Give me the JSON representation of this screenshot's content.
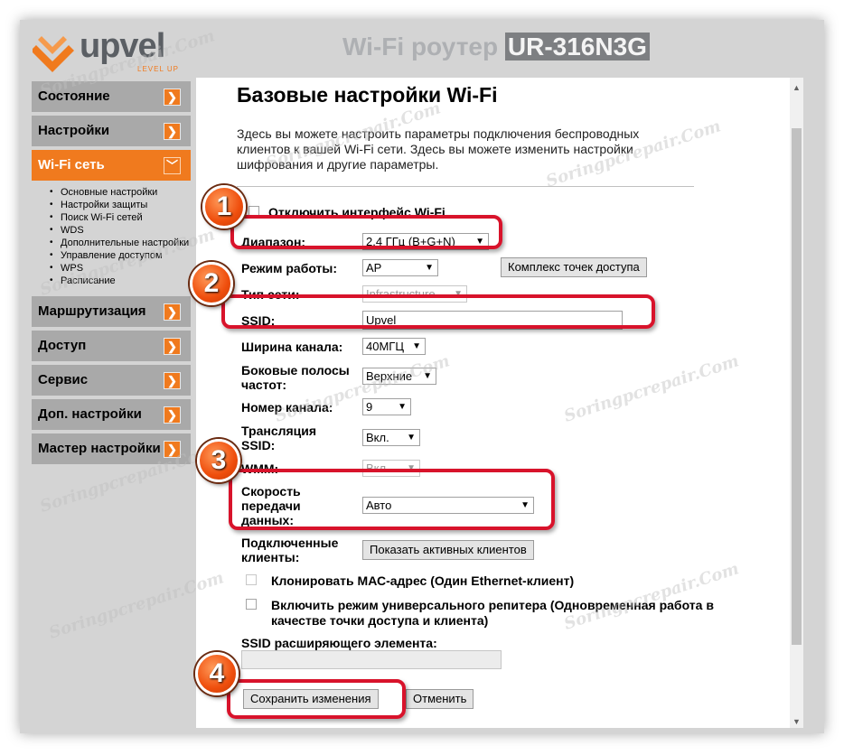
{
  "header": {
    "logo_text": "upvel",
    "logo_tagline": "LEVEL UP",
    "title_prefix": "Wi-Fi роутер",
    "title_model": "UR-316N3G"
  },
  "sidebar": {
    "items": [
      {
        "label": "Состояние"
      },
      {
        "label": "Настройки"
      },
      {
        "label": "Wi-Fi сеть",
        "active": true
      },
      {
        "label": "Маршрутизация"
      },
      {
        "label": "Доступ"
      },
      {
        "label": "Сервис"
      },
      {
        "label": "Доп. настройки"
      },
      {
        "label": "Мастер настройки"
      }
    ],
    "subitems": [
      "Основные настройки",
      "Настройки защиты",
      "Поиск Wi-Fi сетей",
      "WDS",
      "Дополнительные настройки",
      "Управление доступом",
      "WPS",
      "Расписание"
    ]
  },
  "main": {
    "title": "Базовые настройки Wi-Fi",
    "intro": "Здесь вы можете настроить параметры подключения беспроводных клиентов к вашей Wi-Fi сети. Здесь вы можете изменить настройки шифрования и другие параметры.",
    "disable_wifi_label": "Отключить интерфейс Wi-Fi",
    "band_label": "Диапазон:",
    "band_value": "2.4 ГГц (B+G+N)",
    "mode_label": "Режим работы:",
    "mode_value": "AP",
    "multi_ap_button": "Комплекс точек доступа",
    "network_type_label": "Тип сети:",
    "network_type_value": "Infrastructure",
    "ssid_label": "SSID:",
    "ssid_value": "Upvel",
    "channel_width_label": "Ширина канала:",
    "channel_width_value": "40МГЦ",
    "sideband_label": "Боковые полосы частот:",
    "sideband_value": "Верхние",
    "channel_label": "Номер канала:",
    "channel_value": "9",
    "broadcast_label": "Трансляция SSID:",
    "broadcast_value": "Вкл.",
    "wmm_label": "WMM:",
    "wmm_value": "Вкл.",
    "rate_label": "Скорость передачи данных:",
    "rate_value": "Авто",
    "clients_label": "Подключенные клиенты:",
    "show_clients_button": "Показать активных клиентов",
    "clone_mac_label": "Клонировать МАС-адрес (Один Ethernet-клиент)",
    "repeater_label": "Включить режим универсального репитера (Одновременная работа в качестве точки доступа и клиента)",
    "ext_ssid_label": "SSID расширяющего элемента:",
    "ext_ssid_value": "",
    "save_button": "Сохранить изменения",
    "cancel_button": "Отменить"
  },
  "annotations": [
    "1",
    "2",
    "3",
    "4"
  ],
  "watermark": "Soringpcrepair.Com",
  "colors": {
    "accent": "#f07a1e",
    "highlight": "#d8132b"
  }
}
